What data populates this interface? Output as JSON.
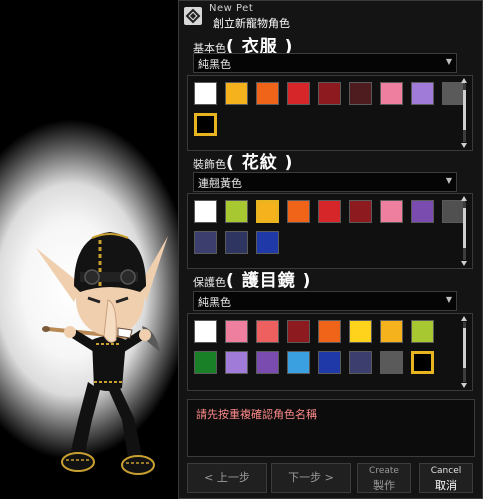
{
  "window": {
    "title_en": "New Pet",
    "title_zh": "創立新寵物角色"
  },
  "sections": [
    {
      "label_prefix": "基本色",
      "label_big": "( 衣服 )",
      "dropdown_value": "純黑色",
      "colors": [
        "#ffffff",
        "#f5b21c",
        "#f0641a",
        "#d6262a",
        "#8c1a1e",
        "#4e1c1e",
        "#ee7f9e",
        "#a07cd8",
        "#5a5a5a",
        "#000000"
      ],
      "selected_index": 9
    },
    {
      "label_prefix": "裝飾色",
      "label_big": "( 花紋 )",
      "dropdown_value": "連翹黃色",
      "colors": [
        "#ffffff",
        "#a8c832",
        "#f5b21c",
        "#f0641a",
        "#d6262a",
        "#8c1a1e",
        "#ee7f9e",
        "#7a4cb0",
        "#505050",
        "#3c3f6e",
        "#2d3560",
        "#1f3aa8"
      ],
      "selected_index": 2
    },
    {
      "label_prefix": "保護色",
      "label_big": "( 護目鏡 )",
      "dropdown_value": "純黑色",
      "colors": [
        "#ffffff",
        "#ee7f9e",
        "#ee6060",
        "#8c1a1e",
        "#f0641a",
        "#ffd21c",
        "#f5b21c",
        "#a8c832",
        "#1a8028",
        "#a07cd8",
        "#7a4cb0",
        "#3aa0e0",
        "#1f3aa8",
        "#3c3f6e",
        "#5a5a5a",
        "#000000"
      ],
      "selected_index": 15
    }
  ],
  "message": "請先按重複確認角色名稱",
  "buttons": {
    "prev": "< 上一步",
    "next": "下一步 >",
    "create_en": "Create",
    "create_zh": "製作",
    "cancel_en": "Cancel",
    "cancel_zh": "取消"
  },
  "accent": {
    "selected_border": "#e8b520",
    "message_color": "#ff8a8a"
  }
}
